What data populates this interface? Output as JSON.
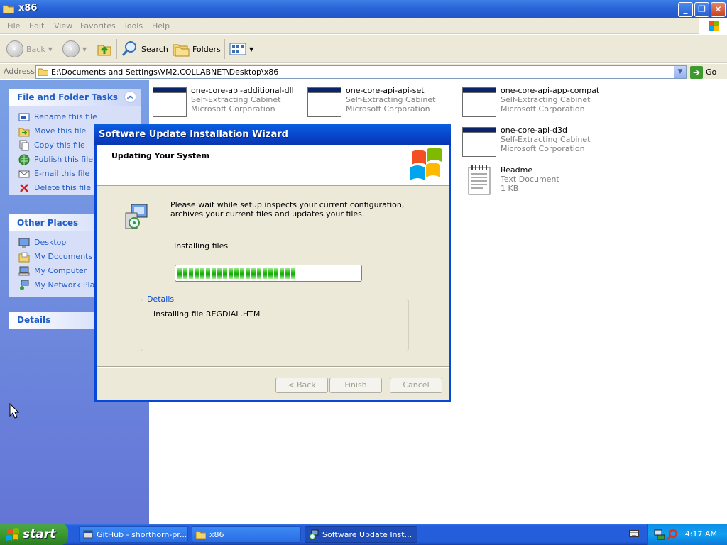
{
  "window": {
    "title": "x86"
  },
  "menu": [
    "File",
    "Edit",
    "View",
    "Favorites",
    "Tools",
    "Help"
  ],
  "toolbar": {
    "back": "Back",
    "search": "Search",
    "folders": "Folders"
  },
  "address": {
    "label": "Address",
    "path": "E:\\Documents and Settings\\VM2.COLLABNET\\Desktop\\x86",
    "go": "Go"
  },
  "taskpane": {
    "file_tasks": {
      "title": "File and Folder Tasks",
      "items": [
        {
          "label": "Rename this file",
          "icon": "rename-icon"
        },
        {
          "label": "Move this file",
          "icon": "move-icon"
        },
        {
          "label": "Copy this file",
          "icon": "copy-icon"
        },
        {
          "label": "Publish this file to the Web",
          "icon": "publish-icon"
        },
        {
          "label": "E-mail this file",
          "icon": "email-icon"
        },
        {
          "label": "Delete this file",
          "icon": "delete-icon"
        }
      ]
    },
    "other_places": {
      "title": "Other Places",
      "items": [
        {
          "label": "Desktop",
          "icon": "desktop-icon"
        },
        {
          "label": "My Documents",
          "icon": "my-documents-icon"
        },
        {
          "label": "My Computer",
          "icon": "my-computer-icon"
        },
        {
          "label": "My Network Places",
          "icon": "network-icon"
        }
      ]
    },
    "details": {
      "title": "Details"
    }
  },
  "files": [
    {
      "name": "one-core-api-additional-dll",
      "type": "Self-Extracting Cabinet",
      "company": "Microsoft Corporation"
    },
    {
      "name": "one-core-api-api-set",
      "type": "Self-Extracting Cabinet",
      "company": "Microsoft Corporation"
    },
    {
      "name": "one-core-api-app-compat",
      "type": "Self-Extracting Cabinet",
      "company": "Microsoft Corporation"
    },
    {
      "name": "one-core-api-d3d",
      "type": "Self-Extracting Cabinet",
      "company": "Microsoft Corporation"
    },
    {
      "name": "Readme",
      "type": "Text Document",
      "size": "1 KB"
    }
  ],
  "wizard": {
    "title": "Software Update Installation Wizard",
    "header": "Updating Your System",
    "message": "Please wait while setup inspects your current configuration, archives your current files and updates your files.",
    "status": "Installing files",
    "progress_fraction": 0.68,
    "details_label": "Details",
    "details_text": "Installing file REGDIAL.HTM",
    "buttons": {
      "back": "< Back",
      "finish": "Finish",
      "cancel": "Cancel"
    }
  },
  "taskbar": {
    "start": "start",
    "tasks": [
      {
        "label": "GitHub - shorthorn-pr...",
        "icon": "browser-icon"
      },
      {
        "label": "x86",
        "icon": "folder-icon"
      },
      {
        "label": "Software Update Inst...",
        "icon": "setup-icon"
      }
    ],
    "clock": "4:17 AM"
  },
  "colors": {
    "title_blue": "#0a5fe0",
    "task_link": "#215dc6",
    "progress_green": "#2fc11b",
    "start_green": "#3c9a2e"
  }
}
